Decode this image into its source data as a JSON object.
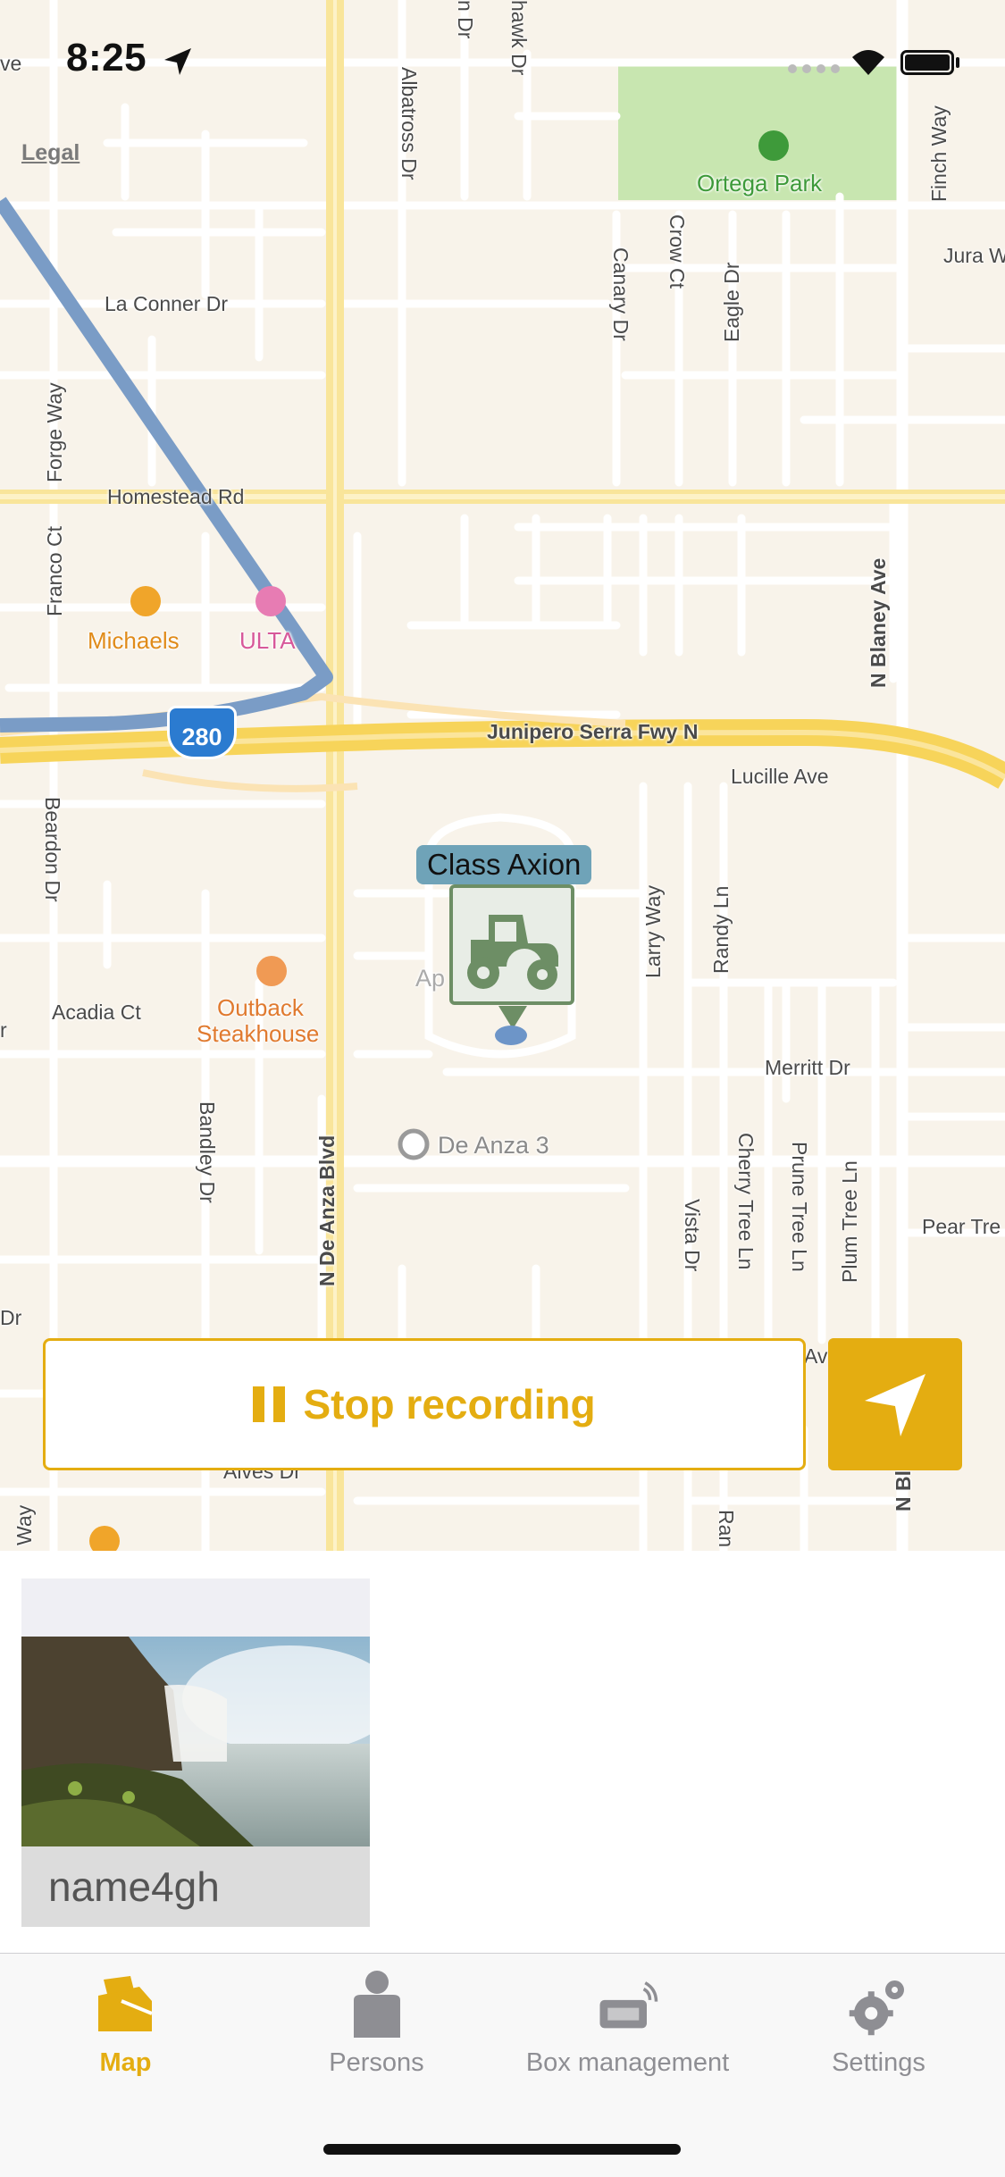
{
  "status_bar": {
    "time": "8:25",
    "icons": [
      "location-arrow-icon",
      "signal-icon",
      "wifi-icon",
      "battery-icon"
    ]
  },
  "map": {
    "legal": "Legal",
    "streets": {
      "la_conner": "La Conner Dr",
      "homestead": "Homestead Rd",
      "forge": "Forge Way",
      "franco": "Franco Ct",
      "albatross": "Albatross Dr",
      "canary": "Canary Dr",
      "crow": "Crow Ct",
      "eagle": "Eagle Dr",
      "finch": "Finch Way",
      "jura": "Jura W",
      "blaney": "N Blaney Ave",
      "junipero": "Junipero Serra Fwy N",
      "lucille": "Lucille Ave",
      "beardon": "Beardon Dr",
      "acadia": "Acadia Ct",
      "bandley": "Bandley Dr",
      "de_anza": "N De Anza Blvd",
      "larry": "Larry Way",
      "randy": "Randy Ln",
      "merritt": "Merritt Dr",
      "vista": "Vista Dr",
      "cherry": "Cherry Tree Ln",
      "prune": "Prune Tree Ln",
      "plum": "Plum Tree Ln",
      "pear": "Pear Tre",
      "alves": "Alves Dr",
      "hawk": "hawk Dr",
      "n_dr": "n Dr",
      "ave_left": "ve",
      "dr_left": "Dr",
      "way_left": "Way",
      "ran": "Ran",
      "av": "Av",
      "n_bl": "N Bl",
      "r_left": "r"
    },
    "pois": {
      "ortega": "Ortega Park",
      "michaels": "Michaels",
      "ulta": "ULTA",
      "outback_1": "Outback",
      "outback_2": "Steakhouse",
      "de_anza3": "De Anza 3",
      "apple_campus": "Ap        us"
    },
    "highway_shield": "280",
    "vehicle": {
      "label": "Class Axion",
      "icon": "tractor-icon"
    },
    "stop_button": "Stop recording",
    "colors": {
      "accent": "#e4ad11",
      "route": "#7a9cc6",
      "park": "#c8e6b0",
      "road_major": "#f9e59a"
    }
  },
  "person_card": {
    "name": "name4gh"
  },
  "tabbar": {
    "tabs": [
      {
        "label": "Map",
        "icon": "map-icon",
        "active": true
      },
      {
        "label": "Persons",
        "icon": "person-icon",
        "active": false
      },
      {
        "label": "Box management",
        "icon": "box-icon",
        "active": false
      },
      {
        "label": "Settings",
        "icon": "gear-icon",
        "active": false
      }
    ]
  }
}
